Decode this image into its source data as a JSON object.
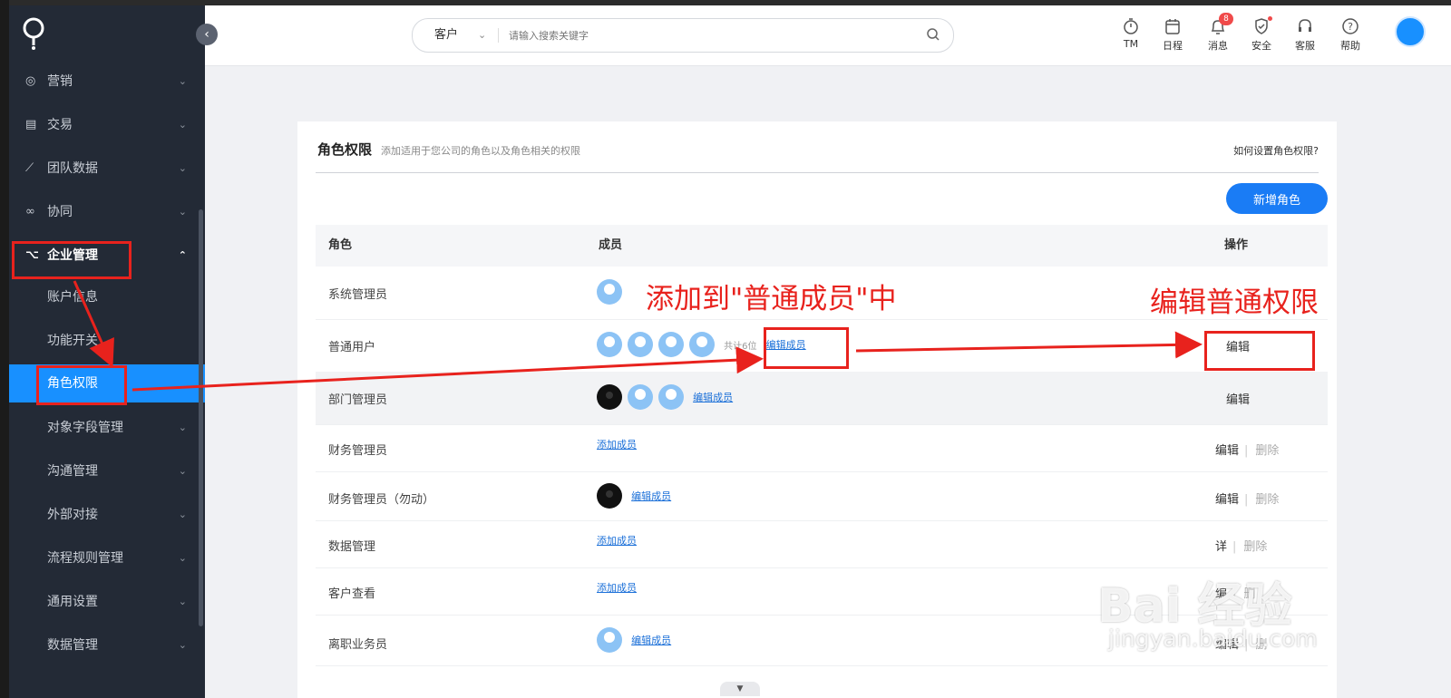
{
  "sidebar": {
    "items": [
      {
        "icon": "target-icon",
        "label": "营销"
      },
      {
        "icon": "document-icon",
        "label": "交易"
      },
      {
        "icon": "chart-line-icon",
        "label": "团队数据"
      },
      {
        "icon": "collaborate-icon",
        "label": "协同"
      },
      {
        "icon": "org-tree-icon",
        "label": "企业管理"
      }
    ],
    "subitems": [
      {
        "label": "账户信息"
      },
      {
        "label": "功能开关"
      },
      {
        "label": "角色权限"
      },
      {
        "label": "对象字段管理"
      },
      {
        "label": "沟通管理"
      },
      {
        "label": "外部对接"
      },
      {
        "label": "流程规则管理"
      },
      {
        "label": "通用设置"
      },
      {
        "label": "数据管理"
      }
    ],
    "active": "角色权限"
  },
  "search": {
    "scope": "客户",
    "placeholder": "请输入搜索关键字"
  },
  "toolbar": {
    "items": [
      {
        "icon": "stopwatch-icon",
        "label": "TM"
      },
      {
        "icon": "calendar-icon",
        "label": "日程"
      },
      {
        "icon": "bell-icon",
        "label": "消息",
        "badge": "8"
      },
      {
        "icon": "shield-icon",
        "label": "安全"
      },
      {
        "icon": "headset-icon",
        "label": "客服"
      },
      {
        "icon": "help-icon",
        "label": "帮助"
      }
    ]
  },
  "page": {
    "title": "角色权限",
    "subtitle": "添加适用于您公司的角色以及角色相关的权限",
    "help_link": "如何设置角色权限?",
    "add_button": "新增角色"
  },
  "table": {
    "headers": [
      "角色",
      "成员",
      "操作"
    ],
    "rows": [
      {
        "role": "系统管理员",
        "avatars": [
          "light"
        ],
        "member_text": "",
        "link": "",
        "edit": "",
        "delete": ""
      },
      {
        "role": "普通用户",
        "avatars": [
          "light",
          "light",
          "light",
          "light"
        ],
        "member_text": "共计6位",
        "link": "编辑成员",
        "edit": "编辑",
        "delete": ""
      },
      {
        "role": "部门管理员",
        "avatars": [
          "dark",
          "light",
          "light"
        ],
        "member_text": "",
        "link": "编辑成员",
        "edit": "编辑",
        "delete": ""
      },
      {
        "role": "财务管理员",
        "avatars": [],
        "member_text": "",
        "link": "添加成员",
        "edit": "编辑",
        "delete": "删除"
      },
      {
        "role": "财务管理员（勿动）",
        "avatars": [
          "dark"
        ],
        "member_text": "",
        "link": "编辑成员",
        "edit": "编辑",
        "delete": "删除"
      },
      {
        "role": "数据管理",
        "avatars": [],
        "member_text": "",
        "link": "添加成员",
        "edit": "详",
        "delete": "删除"
      },
      {
        "role": "客户查看",
        "avatars": [],
        "member_text": "",
        "link": "添加成员",
        "edit": "编",
        "delete": "删"
      },
      {
        "role": "离职业务员",
        "avatars": [
          "light"
        ],
        "member_text": "",
        "link": "编辑成员",
        "edit": "编辑",
        "delete": "删"
      }
    ]
  },
  "annotations": {
    "left_text": "添加到\"普通成员\"中",
    "right_text": "编辑普通权限",
    "color": "#e8221d"
  },
  "watermark": {
    "main": "Bai 经验",
    "sub": "jingyan.baidu.com"
  },
  "colors": {
    "sidebar_bg": "#232a36",
    "accent": "#1890ff",
    "button": "#1a7cf5",
    "annotation": "#e8221d"
  }
}
